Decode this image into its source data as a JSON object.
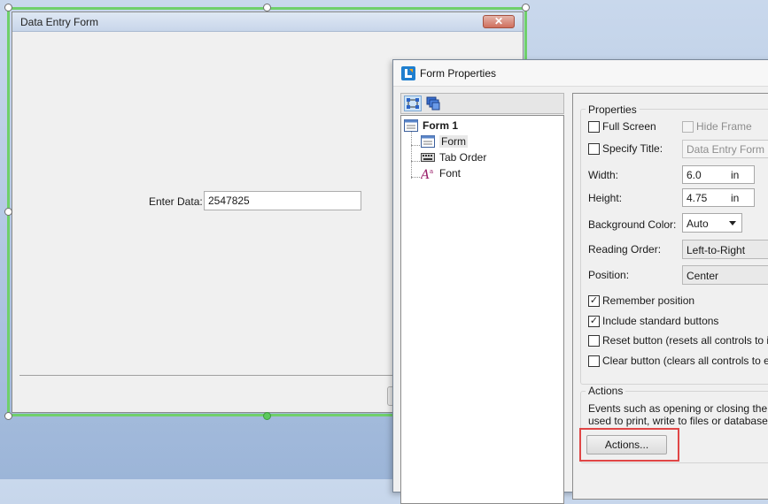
{
  "designer": {
    "window_title": "Data Entry Form",
    "close_glyph": "✕",
    "field_label": "Enter Data:",
    "field_value": "2547825"
  },
  "dialog": {
    "title": "Form Properties",
    "toolbar": [
      {
        "icon": "tree-view-icon",
        "active": true
      },
      {
        "icon": "cascade-windows-icon",
        "active": false
      }
    ],
    "tree": {
      "root": "Form 1",
      "items": [
        {
          "label": "Form",
          "icon": "form-icon",
          "selected": true
        },
        {
          "label": "Tab Order",
          "icon": "keyboard-icon",
          "selected": false
        },
        {
          "label": "Font",
          "icon": "font-icon",
          "selected": false
        }
      ]
    },
    "properties": {
      "group_label": "Properties",
      "full_screen": {
        "label": "Full Screen",
        "checked": false
      },
      "hide_frame": {
        "label": "Hide Frame",
        "checked": false,
        "enabled": false
      },
      "specify_title": {
        "label": "Specify Title:",
        "checked": false,
        "value": "Data Entry Form"
      },
      "width": {
        "label": "Width:",
        "value": "6.0",
        "unit": "in"
      },
      "height": {
        "label": "Height:",
        "value": "4.75",
        "unit": "in"
      },
      "background_color": {
        "label": "Background Color:",
        "value": "Auto"
      },
      "reading_order": {
        "label": "Reading Order:",
        "value": "Left-to-Right"
      },
      "position": {
        "label": "Position:",
        "value": "Center"
      },
      "remember_position": {
        "label": "Remember position",
        "checked": true
      },
      "include_standard_buttons": {
        "label": "Include standard buttons",
        "checked": true
      },
      "reset_button": {
        "label": "Reset button (resets all controls to initi",
        "checked": false
      },
      "clear_button": {
        "label": "Clear button (clears all controls to empt",
        "checked": false
      }
    },
    "actions": {
      "group_label": "Actions",
      "description_line1": "Events such as opening or closing the form",
      "description_line2": "used to print, write to files or databases, s",
      "button_label": "Actions..."
    }
  },
  "colors": {
    "selection_frame": "#6fd06a",
    "highlight": "#e04646"
  }
}
